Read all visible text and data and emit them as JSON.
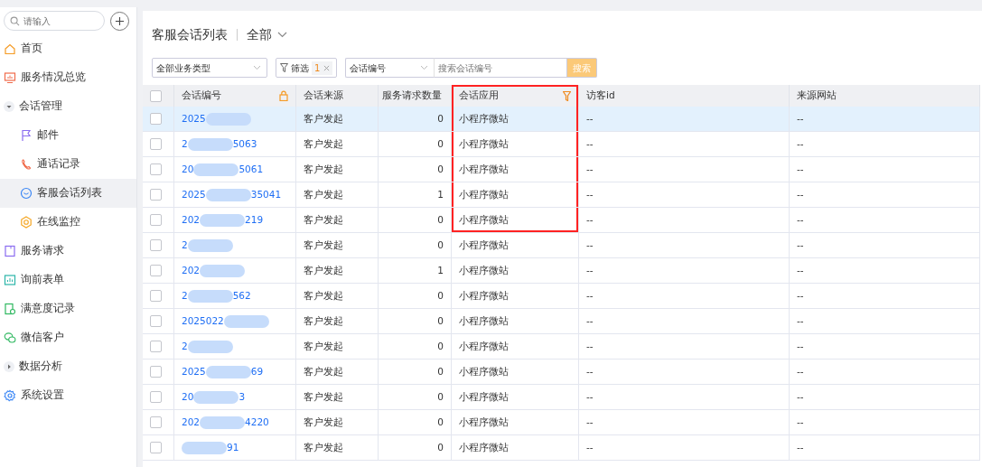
{
  "sidebar": {
    "search": {
      "placeholder": "请输入"
    },
    "items": [
      {
        "label": "首页",
        "selected": false
      },
      {
        "label": "服务情况总览",
        "selected": false
      },
      {
        "label": "会话管理",
        "expanded": true,
        "selected": false,
        "children": [
          {
            "label": "邮件",
            "selected": false
          },
          {
            "label": "通话记录",
            "selected": false
          },
          {
            "label": "客服会话列表",
            "selected": true
          },
          {
            "label": "在线监控",
            "selected": false
          }
        ]
      },
      {
        "label": "服务请求",
        "selected": false
      },
      {
        "label": "询前表单",
        "selected": false
      },
      {
        "label": "满意度记录",
        "selected": false
      },
      {
        "label": "微信客户",
        "selected": false
      },
      {
        "label": "数据分析",
        "expanded": false,
        "selected": false
      },
      {
        "label": "系统设置",
        "selected": false
      }
    ]
  },
  "header": {
    "title": "客服会话列表",
    "scope": "全部"
  },
  "toolbar": {
    "business_type": "全部业务类型",
    "filter_label": "筛选",
    "filter_count": "1",
    "search_field": "会话编号",
    "search_placeholder": "搜索会话编号",
    "search_button": "搜索"
  },
  "table": {
    "select_all": {
      "checked": false
    },
    "columns": [
      {
        "label": "会话编号"
      },
      {
        "label": "会话来源"
      },
      {
        "label": "服务请求数量"
      },
      {
        "label": "会话应用"
      },
      {
        "label": "访客id"
      },
      {
        "label": "来源网站"
      }
    ],
    "rows": [
      {
        "id_start": "2025",
        "id_end": "",
        "source": "客户发起",
        "requests": "0",
        "app": "小程序微站",
        "visitor": "--",
        "site": "--",
        "selected": true,
        "highlighted": true
      },
      {
        "id_start": "2",
        "id_end": "5063",
        "source": "客户发起",
        "requests": "0",
        "app": "小程序微站",
        "visitor": "--",
        "site": "--",
        "selected": false,
        "highlighted": true
      },
      {
        "id_start": "20",
        "id_end": "5061",
        "source": "客户发起",
        "requests": "0",
        "app": "小程序微站",
        "visitor": "--",
        "site": "--",
        "selected": false,
        "highlighted": true
      },
      {
        "id_start": "2025",
        "id_end": "35041",
        "source": "客户发起",
        "requests": "1",
        "app": "小程序微站",
        "visitor": "--",
        "site": "--",
        "selected": false,
        "highlighted": true
      },
      {
        "id_start": "202",
        "id_end": "219",
        "source": "客户发起",
        "requests": "0",
        "app": "小程序微站",
        "visitor": "--",
        "site": "--",
        "selected": false,
        "highlighted": true
      },
      {
        "id_start": "2",
        "id_end": "",
        "source": "客户发起",
        "requests": "0",
        "app": "小程序微站",
        "visitor": "--",
        "site": "--",
        "selected": false,
        "highlighted": false
      },
      {
        "id_start": "202",
        "id_end": "",
        "source": "客户发起",
        "requests": "1",
        "app": "小程序微站",
        "visitor": "--",
        "site": "--",
        "selected": false,
        "highlighted": false
      },
      {
        "id_start": "2",
        "id_end": "562",
        "source": "客户发起",
        "requests": "0",
        "app": "小程序微站",
        "visitor": "--",
        "site": "--",
        "selected": false,
        "highlighted": false
      },
      {
        "id_start": "2025022",
        "id_end": "",
        "source": "客户发起",
        "requests": "0",
        "app": "小程序微站",
        "visitor": "--",
        "site": "--",
        "selected": false,
        "highlighted": false
      },
      {
        "id_start": "2",
        "id_end": "",
        "source": "客户发起",
        "requests": "0",
        "app": "小程序微站",
        "visitor": "--",
        "site": "--",
        "selected": false,
        "highlighted": false
      },
      {
        "id_start": "2025",
        "id_end": "69",
        "source": "客户发起",
        "requests": "0",
        "app": "小程序微站",
        "visitor": "--",
        "site": "--",
        "selected": false,
        "highlighted": false
      },
      {
        "id_start": "20",
        "id_end": "3",
        "source": "客户发起",
        "requests": "0",
        "app": "小程序微站",
        "visitor": "--",
        "site": "--",
        "selected": false,
        "highlighted": false
      },
      {
        "id_start": "202",
        "id_end": "4220",
        "source": "客户发起",
        "requests": "0",
        "app": "小程序微站",
        "visitor": "--",
        "site": "--",
        "selected": false,
        "highlighted": false
      },
      {
        "id_start": "",
        "id_end": "91",
        "source": "客户发起",
        "requests": "0",
        "app": "小程序微站",
        "visitor": "--",
        "site": "--",
        "selected": false,
        "highlighted": false
      }
    ]
  }
}
